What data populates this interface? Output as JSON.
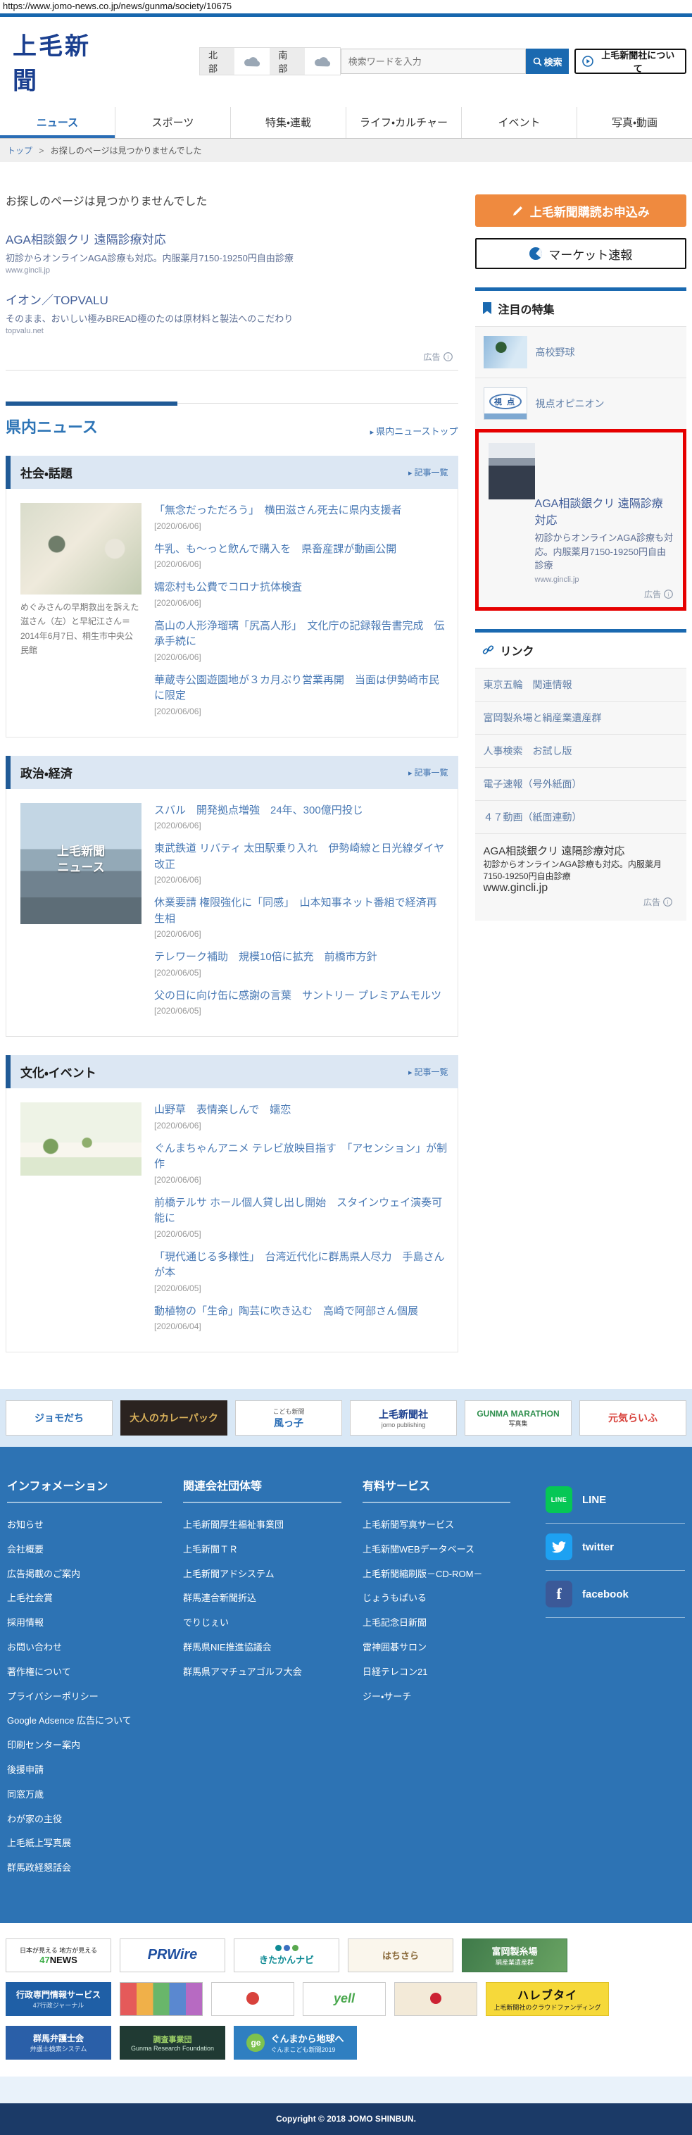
{
  "page": {
    "url": "https://www.jomo-news.co.jp/news/gunma/society/10675",
    "copyright": "Copyright © 2018 JOMO SHINBUN."
  },
  "header": {
    "logo": "上毛新聞",
    "weather_north": "北部",
    "weather_south": "南部",
    "search_placeholder": "検索ワードを入力",
    "search_button": "検索",
    "about_button": "上毛新聞社について"
  },
  "nav": {
    "items": [
      "ニュース",
      "スポーツ",
      "特集・連載",
      "ライフ・カルチャー",
      "イベント",
      "写真・動画"
    ]
  },
  "breadcrumb": {
    "home": "トップ",
    "separator": ">",
    "current": "お探しのページは見つかりませんでした"
  },
  "main": {
    "error_message": "お探しのページは見つかりませんでした",
    "ad_label": "広告",
    "text_ads": [
      {
        "title": "AGA相談銀クリ 遠隔診療対応",
        "desc": "初診からオンラインAGA診療も対応。内服薬月7150-19250円自由診療",
        "url": "www.gincli.jp"
      },
      {
        "title": "イオン／TOPVALU",
        "desc": "そのまま、おいしい極みBREAD極のたのは原材料と製法へのこだわり",
        "url": "topvalu.net"
      }
    ],
    "kennai_title": "県内ニュース",
    "kennai_top_link": "県内ニューストップ",
    "list_link": "記事一覧",
    "society": {
      "title": "社会・話題",
      "caption": "めぐみさんの早期救出を訴えた滋さん（左）と早紀江さん＝2014年6月7日、桐生市中央公民館",
      "articles": [
        {
          "title": "「無念だっただろう」　横田滋さん死去に県内支援者",
          "date": "[2020/06/06]"
        },
        {
          "title": "牛乳、も～っと飲んで購入を　県畜産課が動画公開",
          "date": "[2020/06/06]"
        },
        {
          "title": "嬬恋村も公費でコロナ抗体検査",
          "date": "[2020/06/06]"
        },
        {
          "title": "高山の人形浄瑠璃「尻高人形」　文化庁の記録報告書完成　伝承手続に",
          "date": "[2020/06/06]"
        },
        {
          "title": "華蔵寺公園遊園地が３カ月ぶり営業再開　当面は伊勢崎市民に限定",
          "date": "[2020/06/06]"
        }
      ]
    },
    "politics": {
      "title": "政治・経済",
      "thumb_overlay": "上毛新聞\nニュース",
      "articles": [
        {
          "title": "スバル　開発拠点増強　24年、300億円投じ",
          "date": "[2020/06/06]"
        },
        {
          "title": "東武鉄道 リバティ 太田駅乗り入れ　伊勢崎線と日光線ダイヤ改正",
          "date": "[2020/06/06]"
        },
        {
          "title": "休業要請 権限強化に「同感」　山本知事ネット番組で経済再生相",
          "date": "[2020/06/06]"
        },
        {
          "title": "テレワーク補助　規模10倍に拡充　前橋市方針",
          "date": "[2020/06/05]"
        },
        {
          "title": "父の日に向け缶に感謝の言葉　サントリー プレミアムモルツ",
          "date": "[2020/06/05]"
        }
      ]
    },
    "culture": {
      "title": "文化・イベント",
      "articles": [
        {
          "title": "山野草　表情楽しんで　嬬恋",
          "date": "[2020/06/06]"
        },
        {
          "title": "ぐんまちゃんアニメ テレビ放映目指す　「アセンション」が制作",
          "date": "[2020/06/06]"
        },
        {
          "title": "前橋テルサ ホール個人貸し出し開始　スタインウェイ演奏可能に",
          "date": "[2020/06/05]"
        },
        {
          "title": "「現代通じる多様性」　台湾近代化に群馬県人尽力　手島さんが本",
          "date": "[2020/06/05]"
        },
        {
          "title": "動植物の「生命」陶芸に吹き込む　高崎で阿部さん個展",
          "date": "[2020/06/04]"
        }
      ]
    }
  },
  "sidebar": {
    "subscribe_button": "上毛新聞購読お申込み",
    "market_button": "マーケット速報",
    "featured_title": "注目の特集",
    "featured_items": [
      "高校野球",
      "視点オピニオン"
    ],
    "shiten_badge": "視 点",
    "ad": {
      "title": "AGA相談銀クリ 遠隔診療対応",
      "desc": "初診からオンラインAGA診療も対応。内服薬月7150-19250円自由診療",
      "url": "www.gincli.jp",
      "label": "広告"
    },
    "links_title": "リンク",
    "links": [
      "東京五輪　関連情報",
      "富岡製糸場と絹産業遺産群",
      "人事検索　お試し版",
      "電子速報（号外紙面）",
      "４７動画（紙面連動）"
    ]
  },
  "footer": {
    "info": {
      "title": "インフォメーション",
      "links": [
        "お知らせ",
        "会社概要",
        "広告掲載のご案内",
        "上毛社会賞",
        "採用情報",
        "お問い合わせ",
        "著作権について",
        "プライバシーポリシー",
        "Google Adsence 広告について",
        "印刷センター案内",
        "後援申請",
        "同窓万歳",
        "わが家の主役",
        "上毛紙上写真展",
        "群馬政経懇話会"
      ]
    },
    "related": {
      "title": "関連会社団体等",
      "links": [
        "上毛新聞厚生福祉事業団",
        "上毛新聞ＴＲ",
        "上毛新聞アドシステム",
        "群馬連合新聞折込",
        "でりじぇい",
        "群馬県NIE推進協議会",
        "群馬県アマチュアゴルフ大会"
      ]
    },
    "paid": {
      "title": "有料サービス",
      "links": [
        "上毛新聞写真サービス",
        "上毛新聞WEBデータベース",
        "上毛新聞縮刷版－CD-ROM－",
        "じょうもばいる",
        "上毛記念日新聞",
        "雷神囲碁サロン",
        "日経テレコン21",
        "ジー・サーチ"
      ]
    },
    "sns": {
      "line": "LINE",
      "twitter": "twitter",
      "facebook": "facebook"
    },
    "band_top": {
      "jomodachi": "ジョモだち",
      "curry": "大人のカレーパック",
      "kazakko_sub": "こども新聞",
      "kazakko": "風っ子",
      "jomopub": "上毛新聞社",
      "jomopub_sub": "jomo publishing",
      "marathon": "GUNMA MARATHON",
      "marathon_sub": "写真集",
      "genki": "元気らいふ"
    },
    "band_bottom": {
      "news47_sub": "日本が見える 地方が見える",
      "news47_47": "47",
      "news47_news": "NEWS",
      "prwire": "PRWire",
      "kitakan": "きたかんナビ",
      "hachisara": "はちさら",
      "tomioka": "富岡製糸場",
      "tomioka_sub": "絹産業遺産群",
      "gyosei": "行政専門情報サービス",
      "gyosei_sub": "47行政ジャーナル",
      "yell": "yell",
      "hare": "ハレブタイ",
      "hare_sub": "上毛新聞社のクラウドファンディング",
      "bengoshi": "群馬弁護士会",
      "bengoshi_sub": "弁護士検索システム",
      "chousa": "調査事業団",
      "chousa_sub": "Gunma Research Foundation",
      "chikyu": "ぐんまから地球へ",
      "chikyu_sub": "ぐんまこども新聞2019",
      "chikyu_ge": "ge"
    }
  }
}
